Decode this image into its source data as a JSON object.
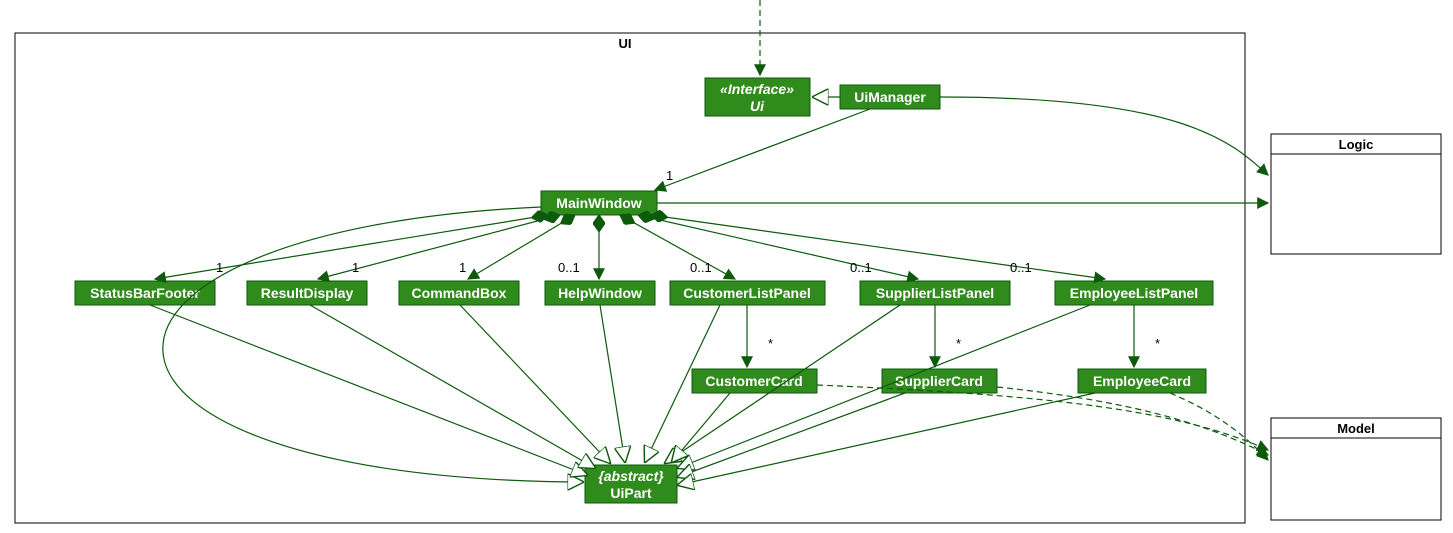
{
  "package": {
    "name": "UI"
  },
  "external": {
    "logic": "Logic",
    "model": "Model"
  },
  "classes": {
    "ui_interface": {
      "stereotype": "«Interface»",
      "name": "Ui"
    },
    "ui_manager": "UiManager",
    "main_window": "MainWindow",
    "status_bar_footer": "StatusBarFooter",
    "result_display": "ResultDisplay",
    "command_box": "CommandBox",
    "help_window": "HelpWindow",
    "customer_list_panel": "CustomerListPanel",
    "supplier_list_panel": "SupplierListPanel",
    "employee_list_panel": "EmployeeListPanel",
    "customer_card": "CustomerCard",
    "supplier_card": "SupplierCard",
    "employee_card": "EmployeeCard",
    "ui_part": {
      "modifier": "{abstract}",
      "name": "UiPart"
    }
  },
  "mult": {
    "main_window": "1",
    "status_bar_footer": "1",
    "result_display": "1",
    "command_box": "1",
    "help_window": "0..1",
    "customer_list_panel": "0..1",
    "supplier_list_panel": "0..1",
    "employee_list_panel": "0..1",
    "customer_card": "*",
    "supplier_card": "*",
    "employee_card": "*"
  }
}
